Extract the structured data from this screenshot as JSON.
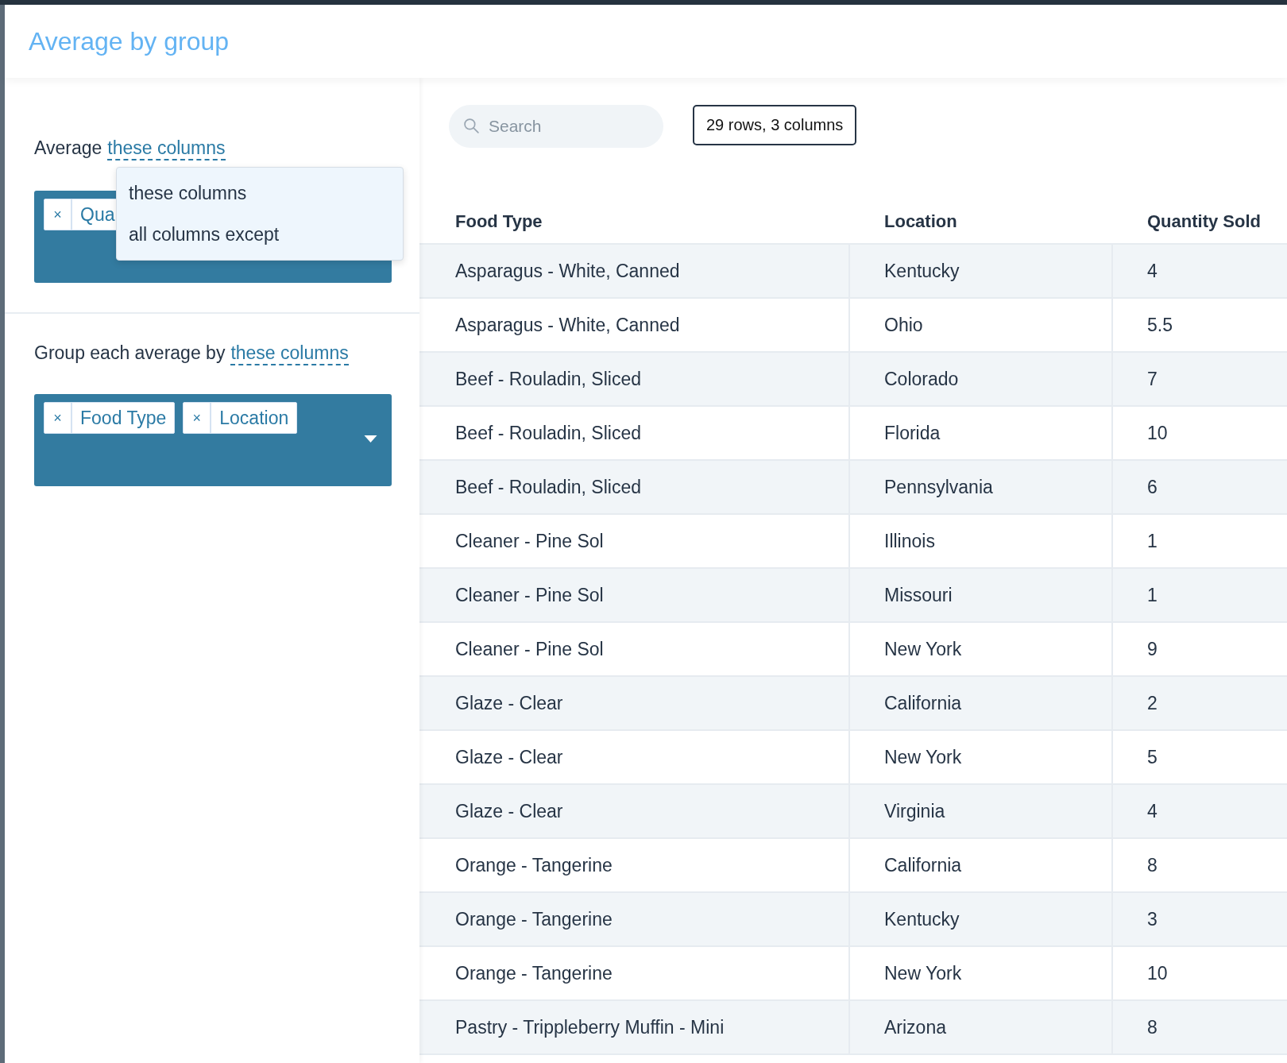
{
  "title": "Average by group",
  "average_section": {
    "label": "Average",
    "mode_link": "these columns",
    "tags": [
      {
        "remove": "×",
        "label": "Qua"
      }
    ],
    "dropdown": {
      "options": [
        {
          "label": "these columns"
        },
        {
          "label": "all columns except"
        }
      ]
    }
  },
  "group_section": {
    "label": "Group each average by",
    "mode_link": "these columns",
    "tags": [
      {
        "remove": "×",
        "label": "Food Type"
      },
      {
        "remove": "×",
        "label": "Location"
      }
    ]
  },
  "search": {
    "placeholder": "Search"
  },
  "summary": "29 rows, 3 columns",
  "table": {
    "columns": [
      "Food Type",
      "Location",
      "Quantity Sold"
    ],
    "rows": [
      [
        "Asparagus - White, Canned",
        "Kentucky",
        "4"
      ],
      [
        "Asparagus - White, Canned",
        "Ohio",
        "5.5"
      ],
      [
        "Beef - Rouladin, Sliced",
        "Colorado",
        "7"
      ],
      [
        "Beef - Rouladin, Sliced",
        "Florida",
        "10"
      ],
      [
        "Beef - Rouladin, Sliced",
        "Pennsylvania",
        "6"
      ],
      [
        "Cleaner - Pine Sol",
        "Illinois",
        "1"
      ],
      [
        "Cleaner - Pine Sol",
        "Missouri",
        "1"
      ],
      [
        "Cleaner - Pine Sol",
        "New York",
        "9"
      ],
      [
        "Glaze - Clear",
        "California",
        "2"
      ],
      [
        "Glaze - Clear",
        "New York",
        "5"
      ],
      [
        "Glaze - Clear",
        "Virginia",
        "4"
      ],
      [
        "Orange - Tangerine",
        "California",
        "8"
      ],
      [
        "Orange - Tangerine",
        "Kentucky",
        "3"
      ],
      [
        "Orange - Tangerine",
        "New York",
        "10"
      ],
      [
        "Pastry - Trippleberry Muffin - Mini",
        "Arizona",
        "8"
      ]
    ]
  }
}
